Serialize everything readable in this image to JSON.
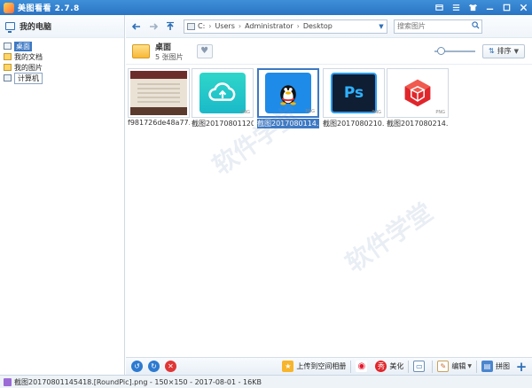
{
  "app": {
    "title": "美图看看 2.7.8"
  },
  "sidebar": {
    "title": "我的电脑",
    "items": [
      {
        "label": "桌面"
      },
      {
        "label": "我的文档"
      },
      {
        "label": "我的图片"
      },
      {
        "label": "计算机"
      }
    ]
  },
  "toolbar": {
    "address": {
      "drive": "C:",
      "crumbs": [
        "Users",
        "Administrator",
        "Desktop"
      ]
    },
    "search_placeholder": "搜索图片"
  },
  "folder": {
    "name": "桌面",
    "count_text": "5 张图片",
    "sort_label": "排序",
    "zoom_level": 0.15
  },
  "thumbnails": [
    {
      "caption": "f981726de48a77...",
      "kind": "photo"
    },
    {
      "caption": "截图20170801120...",
      "kind": "cloud",
      "tag": "PNG"
    },
    {
      "caption": "截图2017080114...",
      "kind": "qq",
      "selected": true,
      "tag": "PNG"
    },
    {
      "caption": "截图2017080210...",
      "kind": "ps",
      "tag": "PNG",
      "text": "Ps"
    },
    {
      "caption": "截图2017080214...",
      "kind": "sketchup",
      "tag": "PNG"
    }
  ],
  "bottombar": {
    "upload_label": "上传到空间相册",
    "beautify_label": "美化",
    "edit_label": "编辑",
    "stitch_label": "拼图"
  },
  "statusbar": {
    "text": "截图20170801145418.[RoundPic].png - 150×150 - 2017-08-01 - 16KB"
  },
  "colors": {
    "accent": "#3d79c4",
    "titlebar": "#2a74c4"
  }
}
